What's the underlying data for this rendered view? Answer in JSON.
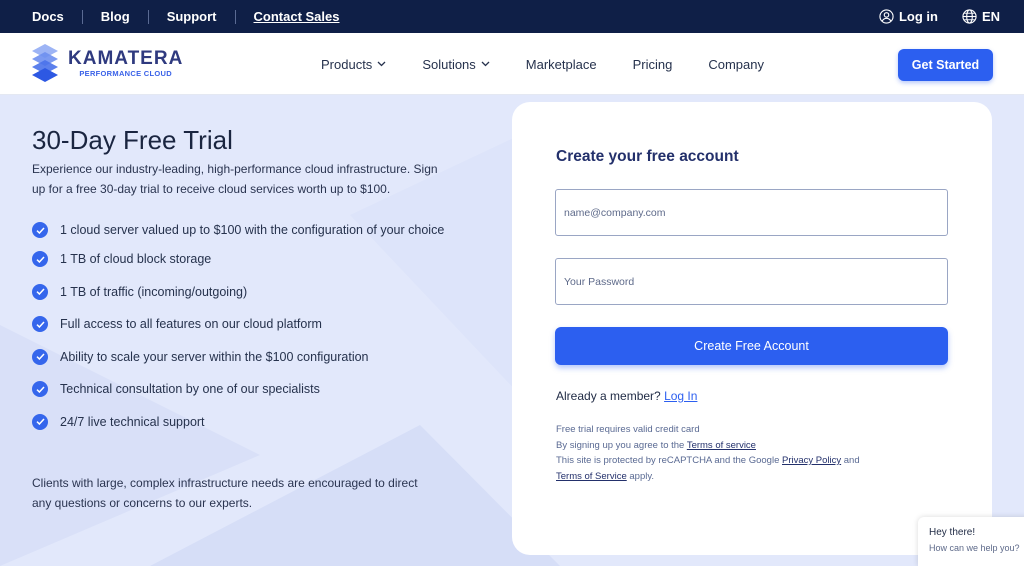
{
  "topbar": {
    "links": [
      {
        "label": "Docs",
        "name": "topbar-link-docs"
      },
      {
        "label": "Blog",
        "name": "topbar-link-blog"
      },
      {
        "label": "Support",
        "name": "topbar-link-support"
      },
      {
        "label": "Contact Sales",
        "name": "topbar-link-contact-sales"
      }
    ],
    "login_label": "Log in",
    "language_label": "EN"
  },
  "nav": {
    "brand_name": "KAMATERA",
    "brand_tagline": "PERFORMANCE CLOUD",
    "menu": [
      {
        "label": "Products",
        "has_dropdown": true
      },
      {
        "label": "Solutions",
        "has_dropdown": true
      },
      {
        "label": "Marketplace",
        "has_dropdown": false
      },
      {
        "label": "Pricing",
        "has_dropdown": false
      },
      {
        "label": "Company",
        "has_dropdown": false
      }
    ],
    "cta_label": "Get Started"
  },
  "hero": {
    "title": "30-Day Free Trial",
    "intro": "Experience our industry-leading, high-performance cloud infrastructure. Sign up for a free 30-day trial to receive cloud services worth up to $100.",
    "benefits": [
      "1 cloud server valued up to $100 with the configuration of your choice",
      "1 TB of cloud block storage",
      "1 TB of traffic (incoming/outgoing)",
      "Full access to all features on our cloud platform",
      "Ability to scale your server within the $100 configuration",
      "Technical consultation by one of our specialists",
      "24/7 live technical support"
    ],
    "note": "Clients with large, complex infrastructure needs are encouraged to direct any questions or concerns to our experts."
  },
  "signup": {
    "title": "Create your free account",
    "email_placeholder": "name@company.com",
    "email_value": "",
    "password_placeholder": "Your Password",
    "password_value": "",
    "submit_label": "Create Free Account",
    "member_prompt": "Already a member?",
    "login_link": "Log In",
    "fine_line1": "Free trial requires valid credit card",
    "fine_line2_prefix": "By signing up you agree to the",
    "terms_link": "Terms of service",
    "fine_line3_prefix": "This site is protected by reCAPTCHA and the Google",
    "privacy_link": "Privacy Policy",
    "fine_line3_suffix": "and",
    "terms_link2": "Terms of Service",
    "fine_line4_suffix": "apply."
  },
  "chat": {
    "greeting": "Hey there!",
    "prompt": "How can we help you?"
  },
  "colors": {
    "topbar_bg": "#0f1f47",
    "accent": "#2c5ff0",
    "page_bg": "#e2e8fb",
    "heading": "#23306b"
  },
  "icons": {
    "login": "user-circle-icon",
    "language": "globe-icon",
    "dropdown": "chevron-down-icon",
    "benefit": "check-circle-icon",
    "logo": "kamatera-logo-mark"
  }
}
